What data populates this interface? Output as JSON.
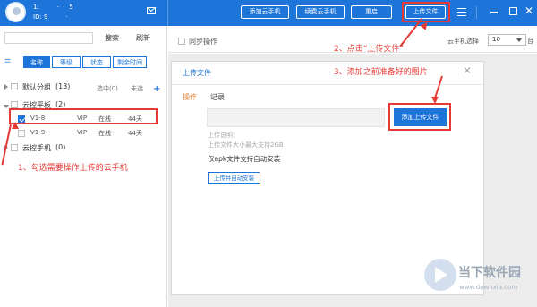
{
  "header": {
    "user_line1": "1:         ·  ·  5",
    "user_line2": "ID: 9         ·",
    "buttons": {
      "add_phone": "添加云手机",
      "renew_phone": "续费云手机",
      "restart": "重启",
      "upload_file": "上传文件"
    }
  },
  "sidebar": {
    "search_placeholder": "",
    "search_label": "搜索",
    "refresh_label": "刷新",
    "sort_tabs": [
      "名称",
      "等级",
      "状态",
      "剩余时间"
    ],
    "default_group": {
      "label": "默认分组",
      "count": "(13)",
      "selected_text": "选中(0)",
      "unselected_text": "未选"
    },
    "tablet_group": {
      "label": "云控平板",
      "count": "(2)"
    },
    "devices": [
      {
        "name": "V1-8",
        "level": "VIP",
        "status": "在线",
        "remaining": "44天",
        "checked": true
      },
      {
        "name": "V1-9",
        "level": "VIP",
        "status": "在线",
        "remaining": "44天",
        "checked": false
      }
    ],
    "phone_group": {
      "label": "云控手机",
      "count": "(0)"
    }
  },
  "toolbar": {
    "sync_label": "同步操作",
    "select_label": "云手机选择",
    "select_value": "10",
    "unit_label": "台"
  },
  "dialog": {
    "title": "上传文件",
    "tab_operation": "操作",
    "tab_record": "记录",
    "add_upload_button": "添加上传文件",
    "desc_label": "上传说明：",
    "desc_size": "上传文件大小最大支持2GB",
    "apk_note": "仅apk文件支持自动安装",
    "install_button": "上传并自动安装"
  },
  "annotations": {
    "step1": "1、勾选需要操作上传的云手机",
    "step2": "2、点击“上传文件”",
    "step3": "3、添加之前准备好的图片"
  },
  "watermark": {
    "brand": "当下软件园",
    "url": "www.downxia.com"
  },
  "colors": {
    "accent": "#1d74d9",
    "annotation": "#e53935",
    "tab_orange": "#e07b2b"
  }
}
